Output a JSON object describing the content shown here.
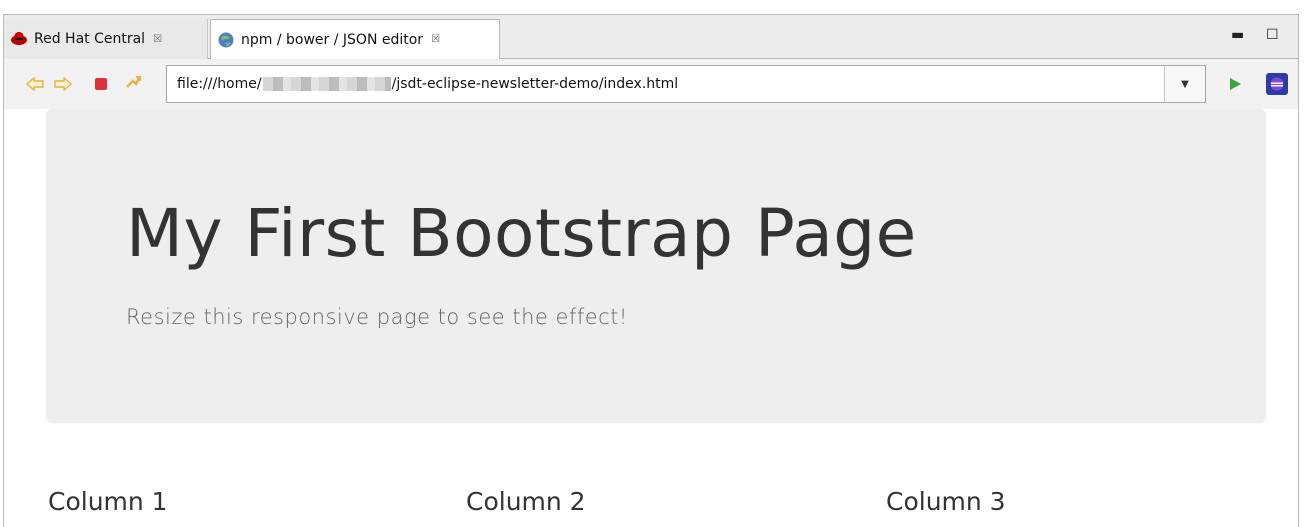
{
  "tabs": [
    {
      "label": "Red Hat Central",
      "icon": "redhat-icon",
      "close": "☒"
    },
    {
      "label": "npm / bower / JSON editor",
      "icon": "globe-icon",
      "close": "☒"
    }
  ],
  "window_controls": {
    "minimize": "▬",
    "maximize": "☐"
  },
  "toolbar": {
    "url_prefix": "file:///home/",
    "url_suffix": "/jsdt-eclipse-newsletter-demo/index.html",
    "dropdown": "▼"
  },
  "page": {
    "title": "My First Bootstrap Page",
    "subtitle": "Resize this responsive page to see the effect!",
    "columns": [
      "Column 1",
      "Column 2",
      "Column 3"
    ]
  },
  "colors": {
    "jumbotron_bg": "#eeeeee",
    "heading": "#333333",
    "subtitle": "#666666",
    "stop_red": "#e0303a",
    "go_green": "#3aa53a",
    "nav_arrow": "#e8b13a"
  }
}
